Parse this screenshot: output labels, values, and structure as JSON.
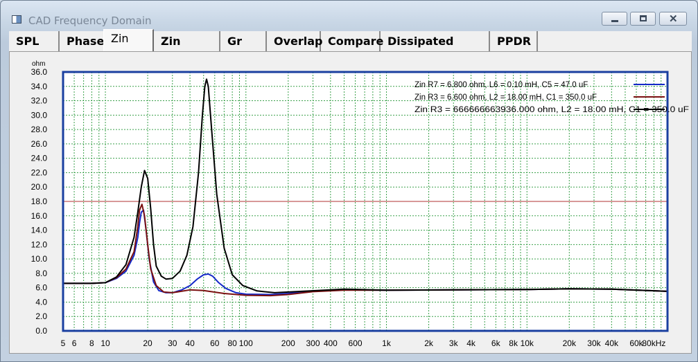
{
  "window": {
    "title": "CAD Frequency Domain"
  },
  "controls": {
    "minimize_icon": "minimize-icon",
    "maximize_icon": "maximize-icon",
    "close_icon": "close-icon"
  },
  "tabs": [
    {
      "label": "SPL"
    },
    {
      "label": "Phase"
    },
    {
      "label": "Zin",
      "active": true
    },
    {
      "label": "Zin Phase"
    },
    {
      "label": "Gr Del"
    },
    {
      "label": "Overlap"
    },
    {
      "label": "Compare"
    },
    {
      "label": "Dissipated Power"
    },
    {
      "label": "PPDR"
    }
  ],
  "colors": {
    "plot_border": "#1a3fa0",
    "grid": "#3aa04a",
    "blue": "#1428c8",
    "red": "#7a1010",
    "black": "#000000",
    "ref_line": "#b03030"
  },
  "chart_data": {
    "type": "line",
    "ylabel": "ohm",
    "ylim": [
      0,
      36
    ],
    "x_scale": "log",
    "xlim": [
      5,
      100000
    ],
    "y_ticks": [
      "0.0",
      "2.0",
      "4.0",
      "6.0",
      "8.0",
      "10.0",
      "12.0",
      "14.0",
      "16.0",
      "18.0",
      "20.0",
      "22.0",
      "24.0",
      "26.0",
      "28.0",
      "30.0",
      "32.0",
      "34.0",
      "36.0"
    ],
    "x_ticks": [
      {
        "v": 5,
        "label": "5"
      },
      {
        "v": 6,
        "label": "6"
      },
      {
        "v": 8,
        "label": "8"
      },
      {
        "v": 10,
        "label": "10"
      },
      {
        "v": 20,
        "label": "20"
      },
      {
        "v": 30,
        "label": "30"
      },
      {
        "v": 40,
        "label": "40"
      },
      {
        "v": 60,
        "label": "60"
      },
      {
        "v": 80,
        "label": "80"
      },
      {
        "v": 100,
        "label": "100"
      },
      {
        "v": 200,
        "label": "200"
      },
      {
        "v": 300,
        "label": "300"
      },
      {
        "v": 400,
        "label": "400"
      },
      {
        "v": 600,
        "label": "600"
      },
      {
        "v": 1000,
        "label": "1k"
      },
      {
        "v": 2000,
        "label": "2k"
      },
      {
        "v": 3000,
        "label": "3k"
      },
      {
        "v": 4000,
        "label": "4k"
      },
      {
        "v": 6000,
        "label": "6k"
      },
      {
        "v": 8000,
        "label": "8k"
      },
      {
        "v": 10000,
        "label": "10k"
      },
      {
        "v": 20000,
        "label": "20k"
      },
      {
        "v": 30000,
        "label": "30k"
      },
      {
        "v": 40000,
        "label": "40k"
      },
      {
        "v": 60000,
        "label": "60k"
      },
      {
        "v": 80000,
        "label": "80kHz"
      }
    ],
    "reference_line": {
      "y": 18.0
    },
    "series": [
      {
        "name": "Zin   R7 = 6.800 ohm, L6 = 0.10 mH, C5 = 47.0 uF",
        "color": "#1428c8",
        "points": [
          [
            5,
            6.6
          ],
          [
            8,
            6.6
          ],
          [
            10,
            6.7
          ],
          [
            12,
            7.3
          ],
          [
            14,
            8.3
          ],
          [
            16,
            10.5
          ],
          [
            17,
            13
          ],
          [
            17.5,
            15
          ],
          [
            18,
            16.5
          ],
          [
            18.7,
            16.8
          ],
          [
            19.5,
            14
          ],
          [
            20.5,
            10
          ],
          [
            22,
            6.8
          ],
          [
            24,
            5.6
          ],
          [
            27,
            5.3
          ],
          [
            30,
            5.3
          ],
          [
            35,
            5.7
          ],
          [
            40,
            6.3
          ],
          [
            45,
            7.2
          ],
          [
            50,
            7.8
          ],
          [
            54,
            7.9
          ],
          [
            58,
            7.6
          ],
          [
            64,
            6.7
          ],
          [
            72,
            5.9
          ],
          [
            85,
            5.3
          ],
          [
            100,
            5.1
          ],
          [
            150,
            5.05
          ],
          [
            200,
            5.2
          ],
          [
            300,
            5.55
          ],
          [
            500,
            5.7
          ],
          [
            1000,
            5.65
          ],
          [
            3000,
            5.7
          ],
          [
            10000,
            5.75
          ],
          [
            20000,
            5.85
          ],
          [
            40000,
            5.8
          ],
          [
            100000,
            5.5
          ]
        ]
      },
      {
        "name": "Zin   R3 = 6.600 ohm, L2 = 18.00 mH, C1 = 350.0 uF",
        "color": "#7a1010",
        "points": [
          [
            5,
            6.6
          ],
          [
            8,
            6.6
          ],
          [
            10,
            6.7
          ],
          [
            12,
            7.4
          ],
          [
            14,
            8.6
          ],
          [
            16,
            11
          ],
          [
            17,
            14.5
          ],
          [
            17.5,
            16.8
          ],
          [
            18.2,
            17.6
          ],
          [
            19,
            16
          ],
          [
            20,
            12
          ],
          [
            21,
            8.6
          ],
          [
            23,
            6.3
          ],
          [
            26,
            5.4
          ],
          [
            30,
            5.3
          ],
          [
            40,
            5.7
          ],
          [
            50,
            5.6
          ],
          [
            70,
            5.2
          ],
          [
            100,
            4.95
          ],
          [
            150,
            4.9
          ],
          [
            200,
            5.05
          ],
          [
            300,
            5.45
          ],
          [
            500,
            5.65
          ],
          [
            1000,
            5.65
          ],
          [
            3000,
            5.7
          ],
          [
            10000,
            5.75
          ],
          [
            20000,
            5.85
          ],
          [
            40000,
            5.8
          ],
          [
            100000,
            5.5
          ]
        ]
      },
      {
        "name": "Zin   R3 = 666666663936.000 ohm, L2 = 18.00 mH, C1 = 350.0 uF",
        "color": "#000000",
        "points": [
          [
            5,
            6.6
          ],
          [
            8,
            6.6
          ],
          [
            10,
            6.7
          ],
          [
            12,
            7.5
          ],
          [
            14,
            9.2
          ],
          [
            16,
            13
          ],
          [
            17,
            16.5
          ],
          [
            18,
            20
          ],
          [
            19,
            22.3
          ],
          [
            20,
            21.2
          ],
          [
            21,
            17
          ],
          [
            22,
            12
          ],
          [
            23,
            9
          ],
          [
            25,
            7.6
          ],
          [
            27,
            7.2
          ],
          [
            30,
            7.3
          ],
          [
            34,
            8.3
          ],
          [
            38,
            10.5
          ],
          [
            42,
            14.5
          ],
          [
            46,
            22
          ],
          [
            49,
            30
          ],
          [
            51,
            34
          ],
          [
            52.5,
            35
          ],
          [
            54,
            34
          ],
          [
            57,
            28
          ],
          [
            62,
            19
          ],
          [
            70,
            11.5
          ],
          [
            80,
            7.8
          ],
          [
            95,
            6.3
          ],
          [
            120,
            5.55
          ],
          [
            160,
            5.3
          ],
          [
            250,
            5.5
          ],
          [
            500,
            5.8
          ],
          [
            1000,
            5.65
          ],
          [
            3000,
            5.7
          ],
          [
            10000,
            5.75
          ],
          [
            20000,
            5.85
          ],
          [
            40000,
            5.8
          ],
          [
            100000,
            5.5
          ]
        ]
      }
    ]
  }
}
